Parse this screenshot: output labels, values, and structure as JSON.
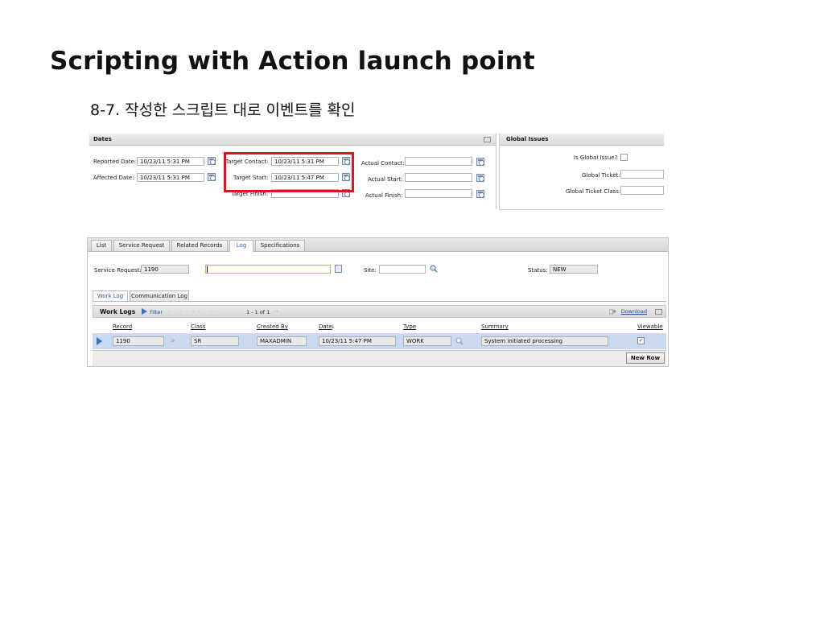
{
  "slide": {
    "title": "Scripting with Action launch point",
    "subtitle": "8-7. 작성한 스크립트 대로 이벤트를 확인"
  },
  "dates": {
    "title": "Dates",
    "reported_date": {
      "label": "Reported Date:",
      "value": "10/23/11 5:31 PM"
    },
    "affected_date": {
      "label": "Affected Date:",
      "value": "10/23/11 5:31 PM"
    },
    "target_contact": {
      "label": "Target Contact:",
      "value": "10/23/11 5:31 PM"
    },
    "target_start": {
      "label": "Target Start:",
      "value": "10/23/11 5:47 PM"
    },
    "target_finish": {
      "label": "Target Finish:",
      "value": ""
    },
    "actual_contact": {
      "label": "Actual Contact:",
      "value": ""
    },
    "actual_start": {
      "label": "Actual Start:",
      "value": ""
    },
    "actual_finish": {
      "label": "Actual Finish:",
      "value": ""
    }
  },
  "global_issues": {
    "title": "Global Issues",
    "is_global_issue": {
      "label": "Is Global Issue?",
      "checked": false
    },
    "global_ticket": {
      "label": "Global Ticket:",
      "value": ""
    },
    "global_ticket_class": {
      "label": "Global Ticket Class:",
      "value": ""
    }
  },
  "tabs": [
    "List",
    "Service Request",
    "Related Records",
    "Log",
    "Specifications"
  ],
  "active_tab": "Log",
  "log": {
    "service_request": {
      "label": "Service Request:",
      "value": "1190"
    },
    "description_value": "",
    "site": {
      "label": "Site:",
      "value": ""
    },
    "status": {
      "label": "Status:",
      "value": "NEW"
    },
    "subtabs": [
      "Work Log",
      "Communication Log"
    ],
    "work_logs": {
      "title": "Work Logs",
      "filter_label": "Filter",
      "pagination": "1 - 1 of 1",
      "download_label": "Download",
      "columns": [
        "Record",
        "Class",
        "Created By",
        "Date",
        "Type",
        "Summary",
        "Viewable"
      ],
      "rows": [
        {
          "record": "1190",
          "class": "SR",
          "created_by": "MAXADMIN",
          "date": "10/23/11 5:47 PM",
          "type": "WORK",
          "summary": "System initiated processing",
          "viewable": true
        }
      ],
      "new_row_label": "New Row"
    }
  },
  "colors": {
    "highlight": "#e0141e",
    "link": "#1a4fa3",
    "selected_row": "#c9d9ef"
  }
}
